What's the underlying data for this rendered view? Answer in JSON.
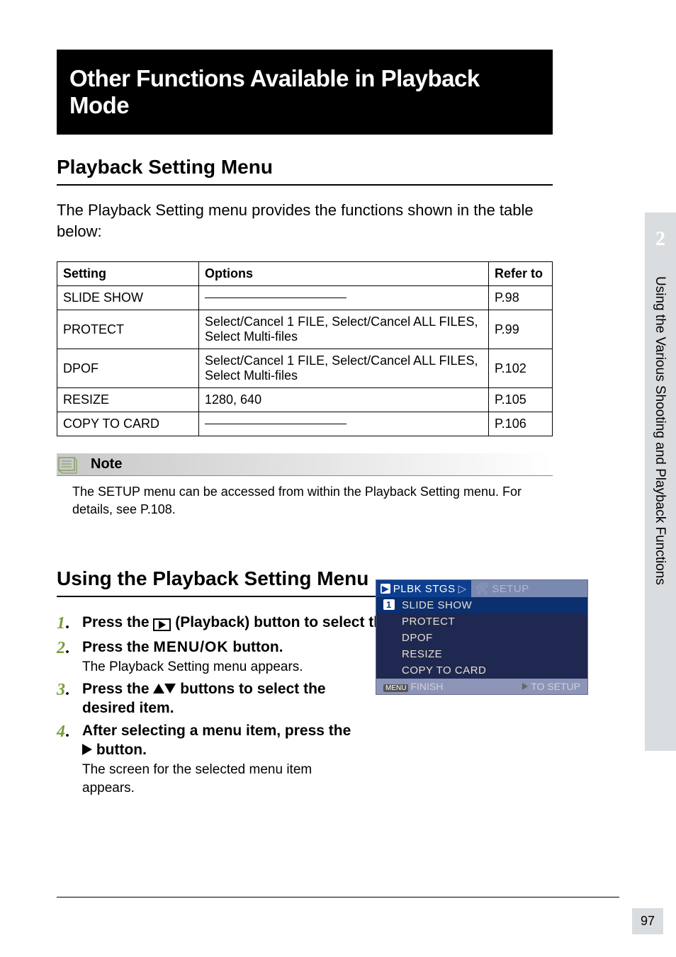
{
  "sidebar": {
    "chapter_number": "2",
    "chapter_title": "Using the Various Shooting and Playback Functions"
  },
  "page_number": "97",
  "title": "Other Functions Available in Playback Mode",
  "section1": {
    "heading": "Playback Setting Menu",
    "intro": "The Playback Setting menu provides the functions shown in the table below:"
  },
  "table": {
    "headers": {
      "c1": "Setting",
      "c2": "Options",
      "c3": "Refer to"
    },
    "rows": [
      {
        "setting": "SLIDE SHOW",
        "options": "",
        "dash": true,
        "ref": "P.98"
      },
      {
        "setting": "PROTECT",
        "options": "Select/Cancel 1 FILE, Select/Cancel ALL FILES, Select Multi-files",
        "dash": false,
        "ref": "P.99"
      },
      {
        "setting": "DPOF",
        "options": "Select/Cancel 1 FILE, Select/Cancel ALL FILES, Select Multi-files",
        "dash": false,
        "ref": "P.102"
      },
      {
        "setting": "RESIZE",
        "options": "1280, 640",
        "dash": false,
        "ref": "P.105"
      },
      {
        "setting": "COPY TO CARD",
        "options": "",
        "dash": true,
        "ref": "P.106"
      }
    ]
  },
  "note": {
    "label": "Note",
    "body": "The SETUP menu can be accessed from within the Playback Setting menu. For details, see P.108."
  },
  "section2": {
    "heading": "Using the Playback Setting Menu"
  },
  "steps": [
    {
      "n": "1",
      "head_pre": "Press the ",
      "head_post": " (Playback) button to select the Playback Mode.",
      "sub": ""
    },
    {
      "n": "2",
      "head_pre": "Press the ",
      "menuok": "MENU/OK",
      "head_post": " button.",
      "sub": "The Playback Setting menu appears."
    },
    {
      "n": "3",
      "head_pre": "Press the ",
      "head_post": " buttons to select the desired item.",
      "sub": ""
    },
    {
      "n": "4",
      "head_pre": "After selecting a menu item, press the ",
      "head_post": " button.",
      "sub": "The screen for the selected menu item appears."
    }
  ],
  "screenshot": {
    "tab_active": "PLBK STGS",
    "tab_inactive": "SETUP",
    "page_indicator": "1",
    "items": [
      "SLIDE SHOW",
      "PROTECT",
      "DPOF",
      "RESIZE",
      "COPY TO CARD"
    ],
    "foot_left_icon": "MENU",
    "foot_left": "FINISH",
    "foot_right": "TO SETUP"
  }
}
